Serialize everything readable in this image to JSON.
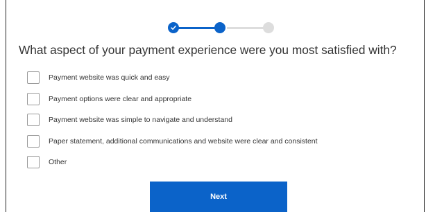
{
  "progress": {
    "total_steps": 3,
    "current_step": 2,
    "completed_steps": 1,
    "active_color": "#0b63c9",
    "inactive_color": "#dddddd"
  },
  "question": "What aspect of your payment experience were you most satisfied with?",
  "options": [
    {
      "label": "Payment website was quick and easy",
      "checked": false
    },
    {
      "label": "Payment options were clear and appropriate",
      "checked": false
    },
    {
      "label": "Payment website was simple to navigate and understand",
      "checked": false
    },
    {
      "label": "Paper statement, additional communications and website were clear and consistent",
      "checked": false
    },
    {
      "label": "Other",
      "checked": false
    }
  ],
  "next_button": {
    "label": "Next",
    "color": "#0b63c9"
  }
}
